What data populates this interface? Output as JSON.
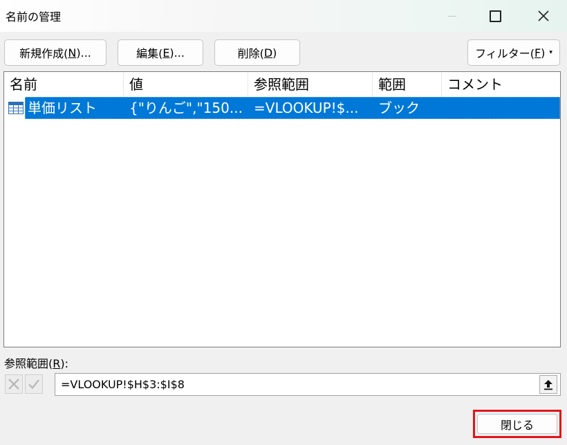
{
  "window": {
    "title": "名前の管理",
    "minimize_icon": "minimize-icon",
    "maximize_icon": "maximize-icon",
    "close_icon": "close-icon"
  },
  "toolbar": {
    "new_label": "新規作成(",
    "new_key": "N",
    "new_suffix": ")...",
    "edit_label": "編集(",
    "edit_key": "E",
    "edit_suffix": ")...",
    "delete_label": "削除(",
    "delete_key": "D",
    "delete_suffix": ")",
    "filter_label": "フィルター(",
    "filter_key": "F",
    "filter_suffix": ")",
    "filter_caret": "▾"
  },
  "list": {
    "columns": [
      "名前",
      "値",
      "参照範囲",
      "範囲",
      "コメント"
    ],
    "rows": [
      {
        "icon": "table-range-icon",
        "name": "単価リスト",
        "value": "{\"りんご\",\"150...",
        "refers_to": "=VLOOKUP!$...",
        "scope": "ブック",
        "comment": "",
        "selected": true
      }
    ],
    "selection_color": "#0078d7"
  },
  "refers_to": {
    "label_prefix": "参照範囲(",
    "label_key": "R",
    "label_suffix": "):",
    "value": "=VLOOKUP!$H$3:$I$8",
    "cancel_icon": "cancel-x-icon",
    "confirm_icon": "checkmark-icon",
    "collapse_icon": "collapse-dialog-icon"
  },
  "footer": {
    "close_label": "閉じる",
    "highlight_color": "#e0151b"
  }
}
